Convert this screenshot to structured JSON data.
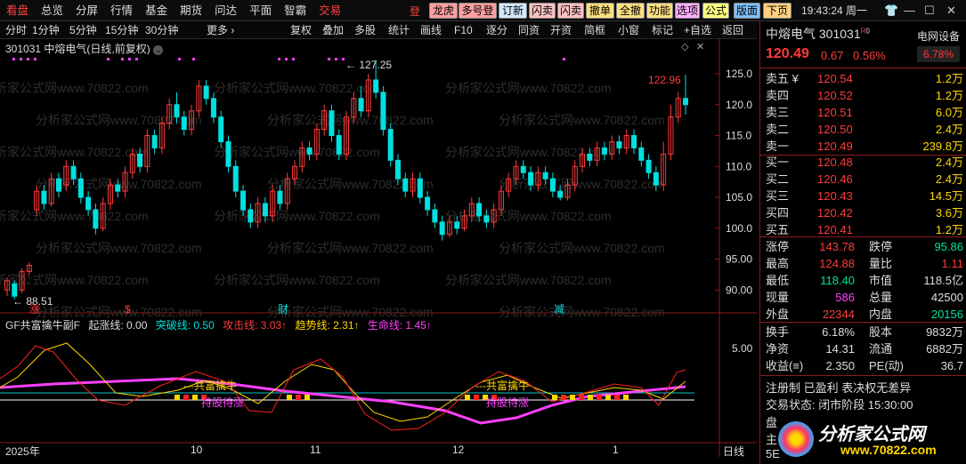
{
  "menu": [
    "看盘",
    "总览",
    "分屏",
    "行情",
    "基金",
    "期货",
    "问达",
    "平面",
    "智霸",
    "交易"
  ],
  "deng": "登",
  "toolbar_buttons": [
    "龙虎",
    "多号登",
    "订新",
    "闪卖",
    "闪卖",
    "撤单",
    "全撤",
    "功能",
    "选项",
    "公式",
    "版面",
    "下页"
  ],
  "clock": "19:43:24 周一",
  "periods": [
    "分时",
    "1分钟",
    "5分钟",
    "15分钟",
    "30分钟",
    "更多 ›"
  ],
  "tools": [
    "复权",
    "叠加",
    "多股",
    "统计",
    "画线",
    "F10",
    "逐分",
    "同资",
    "开资",
    "简框",
    "小窗",
    "标记",
    "+自选",
    "返回"
  ],
  "chart_title": "301031  中熔电气(日线,前复权)",
  "price_axis": [
    "125.0",
    "120.0",
    "115.0",
    "110.0",
    "105.0",
    "100.0",
    "95.00",
    "90.00"
  ],
  "annotations": {
    "high": "127.25",
    "low": "88.51",
    "last_high": "122.96"
  },
  "event_marks": [
    "涨",
    "$",
    "财",
    "减"
  ],
  "indicator": {
    "name": "GF共富擒牛副F",
    "l1": "起涨线: 0.00",
    "l2": "突破线: 0.50",
    "l3": "攻击线: 3.03↑",
    "l4": "趋势线: 2.31↑",
    "l5": "生命线: 1.45↑",
    "axis": "5.00",
    "sig1": "---共富擒牛",
    "sig2": "持股待涨"
  },
  "xaxis": [
    "2025年",
    "10",
    "11",
    "12",
    "1",
    "日线"
  ],
  "watermark": "分析家公式网www.70822.com",
  "quote": {
    "name": "中熔电气",
    "code": "301031",
    "tag": "R",
    "tag2": "0",
    "price": "120.49",
    "chg": "0.67",
    "pct": "0.56%",
    "sector": "电网设备",
    "sector_pct": "6.78%",
    "asks": [
      [
        "卖五 ¥",
        "120.54",
        "1.2万"
      ],
      [
        "卖四",
        "120.52",
        "1.2万"
      ],
      [
        "卖三",
        "120.51",
        "6.0万"
      ],
      [
        "卖二",
        "120.50",
        "2.4万"
      ],
      [
        "卖一",
        "120.49",
        "239.8万"
      ]
    ],
    "bids": [
      [
        "买一",
        "120.48",
        "2.4万"
      ],
      [
        "买二",
        "120.46",
        "2.4万"
      ],
      [
        "买三",
        "120.43",
        "14.5万"
      ],
      [
        "买四",
        "120.42",
        "3.6万"
      ],
      [
        "买五",
        "120.41",
        "1.2万"
      ]
    ],
    "stats": [
      [
        "涨停",
        "143.78",
        "跌停",
        "95.86"
      ],
      [
        "最高",
        "124.88",
        "量比",
        "1.11"
      ],
      [
        "最低",
        "118.40",
        "市值",
        "118.5亿"
      ],
      [
        "现量",
        "586",
        "总量",
        "42500"
      ],
      [
        "外盘",
        "22344",
        "内盘",
        "20156"
      ]
    ],
    "stats2": [
      [
        "换手",
        "6.18%",
        "股本",
        "9832万"
      ],
      [
        "净资",
        "14.31",
        "流通",
        "6882万"
      ],
      [
        "收益(≡)",
        "2.350",
        "PE(动)",
        "36.7"
      ]
    ],
    "reg": "注册制  已盈利  表决权无差异",
    "state": "交易状态: 闭市阶段 15:30:00",
    "logo": "分析家公式网",
    "logo_url": "www.70822.com",
    "misc": [
      "盘",
      "主",
      "5E"
    ]
  },
  "colors": {
    "up": "#ff3b3b",
    "down": "#00e0e0",
    "bg": "#000000"
  },
  "chart_data": {
    "type": "candlestick",
    "ylim": [
      88,
      127
    ]
  }
}
